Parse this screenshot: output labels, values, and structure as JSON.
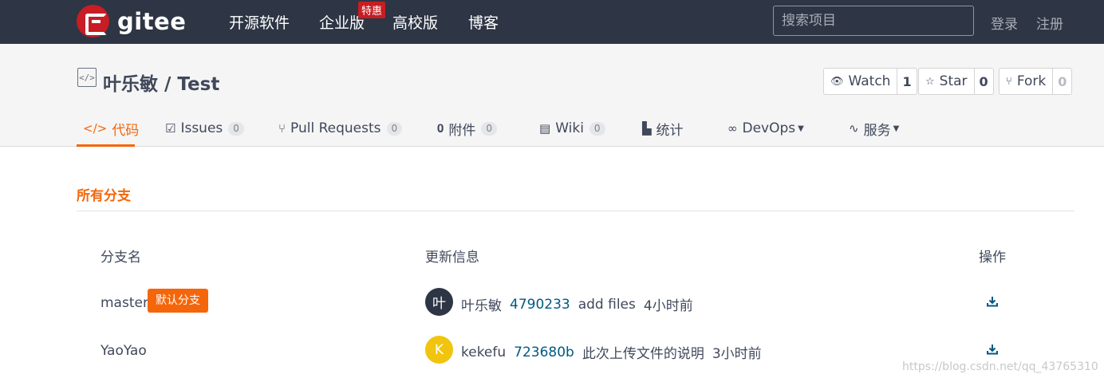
{
  "header": {
    "logo_text": "gitee",
    "nav": [
      "开源软件",
      "企业版",
      "高校版",
      "博客"
    ],
    "promo_badge": "特惠",
    "search_placeholder": "搜索项目",
    "login": "登录",
    "register": "注册"
  },
  "repo": {
    "title": "叶乐敏 / Test",
    "watch": {
      "label": "Watch",
      "count": "1"
    },
    "star": {
      "label": "Star",
      "count": "0"
    },
    "fork": {
      "label": "Fork",
      "count": "0"
    }
  },
  "tabs": [
    {
      "label": "代码",
      "active": true,
      "icon": "code-icon"
    },
    {
      "label": "Issues",
      "count": "0",
      "icon": "issues-icon"
    },
    {
      "label": "Pull Requests",
      "count": "0",
      "icon": "pull-request-icon"
    },
    {
      "label": "附件",
      "count": "0",
      "icon": "attachment-icon"
    },
    {
      "label": "Wiki",
      "count": "0",
      "icon": "wiki-icon"
    },
    {
      "label": "统计",
      "icon": "stats-icon"
    },
    {
      "label": "DevOps",
      "icon": "devops-icon"
    },
    {
      "label": "服务",
      "icon": "service-icon"
    }
  ],
  "branches": {
    "section_title": "所有分支",
    "columns": [
      "分支名",
      "更新信息",
      "操作"
    ],
    "default_tag": "默认分支",
    "rows": [
      {
        "name": "master",
        "is_default": true,
        "avatar_text": "叶",
        "avatar_color": "#2e3544",
        "author": "叶乐敏",
        "sha": "4790233",
        "message": "add files",
        "time": "4小时前"
      },
      {
        "name": "YaoYao",
        "is_default": false,
        "avatar_text": "K",
        "avatar_color": "#f1c40f",
        "author": "kekefu",
        "sha": "723680b",
        "message": "此次上传文件的说明",
        "time": "3小时前"
      }
    ]
  },
  "watermark": "https://blog.csdn.net/qq_43765310",
  "colors": {
    "accent": "#f5660a",
    "nav_bg": "#2e3544",
    "brand": "#c71d23"
  }
}
